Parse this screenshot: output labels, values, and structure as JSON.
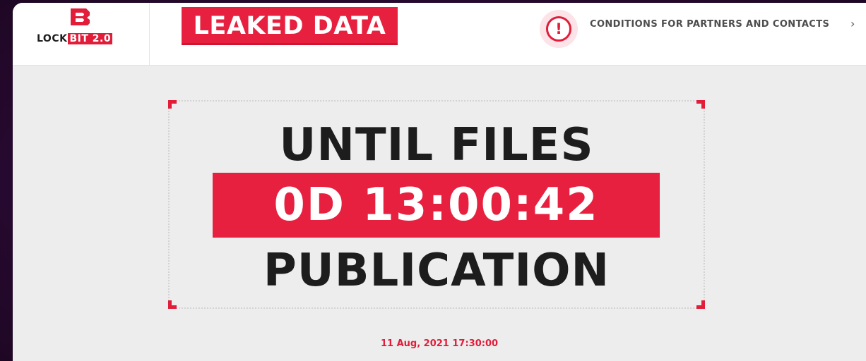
{
  "header": {
    "logo": {
      "word": "LOCK",
      "badge": "BIT 2.0"
    },
    "leaked_data_label": "LEAKED DATA",
    "conditions_link": "CONDITIONS FOR PARTNERS AND CONTACTS",
    "chevron": "›",
    "alert_glyph": "!"
  },
  "countdown": {
    "line1": "UNTIL FILES",
    "timer": "0D 13:00:42",
    "line3": "PUBLICATION"
  },
  "publication_date": "11 Aug, 2021 17:30:00",
  "icons": {
    "logo": "lockbit-logo-icon",
    "alert": "alert-exclamation-icon",
    "chevron": "chevron-right-icon"
  },
  "colors": {
    "accent": "#e8203f",
    "text_dark": "#1d1d1d",
    "page_bg": "#ededed"
  }
}
